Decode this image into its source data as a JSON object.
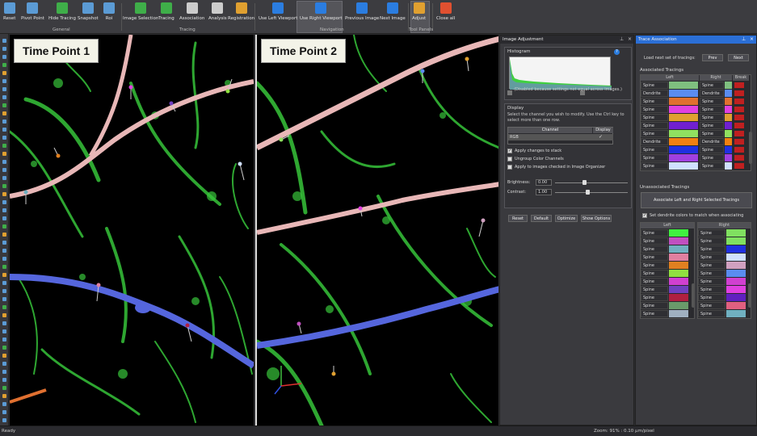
{
  "ribbon": {
    "buttons": [
      {
        "label": "Reset",
        "icon": "home-icon",
        "color": "#5b9bd5"
      },
      {
        "label": "Pivot Point",
        "icon": "crosshair-icon",
        "color": "#5b9bd5"
      },
      {
        "label": "Hide Tracing",
        "icon": "hide-tracing-icon",
        "color": "#3fae49"
      },
      {
        "label": "Snapshot",
        "icon": "camera-icon",
        "color": "#5b9bd5"
      },
      {
        "label": "Roi",
        "icon": "roi-icon",
        "color": "#5b9bd5"
      },
      {
        "label": "Image Selection",
        "icon": "image-selection-icon",
        "color": "#3fae49"
      },
      {
        "label": "Tracing",
        "icon": "pen-icon",
        "color": "#3fae49"
      },
      {
        "label": "Association",
        "icon": "association-icon",
        "color": "#cccccc"
      },
      {
        "label": "Analysis",
        "icon": "table-icon",
        "color": "#cccccc"
      },
      {
        "label": "Registration",
        "icon": "registration-icon",
        "color": "#e0a030"
      },
      {
        "label": "Use Left Viewport",
        "icon": "left-viewport-icon",
        "color": "#2b7de0"
      },
      {
        "label": "Use Right Viewport",
        "icon": "right-viewport-icon",
        "color": "#2b7de0"
      },
      {
        "label": "Previous Image",
        "icon": "arrow-left-icon",
        "color": "#2b7de0"
      },
      {
        "label": "Next Image",
        "icon": "arrow-right-icon",
        "color": "#2b7de0"
      },
      {
        "label": "Adjust",
        "icon": "adjust-icon",
        "color": "#e0a030"
      },
      {
        "label": "Close all",
        "icon": "close-all-icon",
        "color": "#e05030"
      }
    ],
    "groups": {
      "general": "General",
      "tracing": "Tracing",
      "navigation": "Navigation",
      "tool_panels": "Tool Panels"
    }
  },
  "viewports": {
    "left_title": "Time Point 1",
    "right_title": "Time Point 2"
  },
  "image_adjustment": {
    "title": "Image Adjustment",
    "histogram_label": "Histogram",
    "histogram_note": "(Disabled because settings not equal across images.)",
    "display_label": "Display",
    "display_help": "Select the channel you wish to modify. Use the Ctrl key to select more than one row.",
    "table_headers": {
      "channel": "Channel",
      "display": "Display"
    },
    "channel_row": {
      "channel": "RGB",
      "display": "✓"
    },
    "options": [
      {
        "label": "Apply changes to stack",
        "checked": true
      },
      {
        "label": "Ungroup Color Channels",
        "checked": false
      },
      {
        "label": "Apply to images checked in Image Organizer",
        "checked": false
      }
    ],
    "brightness_label": "Brightness:",
    "brightness_value": "0.00",
    "contrast_label": "Contrast:",
    "contrast_value": "1.00",
    "buttons": [
      "Reset",
      "Default",
      "Optimize",
      "Show Options"
    ]
  },
  "trace_association": {
    "title": "Trace Association",
    "load_label": "Load next set of tracings:",
    "prev_label": "Prev",
    "next_label": "Next",
    "associated_label": "Associated Tracings",
    "assoc_headers": {
      "left": "Left",
      "right": "Right",
      "break": "Break"
    },
    "associated": [
      {
        "left": "Spine",
        "lc": "#7fbf7f",
        "right": "Spine",
        "rc": "#7fbf7f"
      },
      {
        "left": "Dendrite",
        "lc": "#5a8cf0",
        "right": "Dendrite",
        "rc": "#5a8cf0"
      },
      {
        "left": "Spine",
        "lc": "#e07030",
        "right": "Spine",
        "rc": "#e07030"
      },
      {
        "left": "Spine",
        "lc": "#e040e0",
        "right": "Spine",
        "rc": "#e040e0"
      },
      {
        "left": "Spine",
        "lc": "#e0a030",
        "right": "Spine",
        "rc": "#e0a030"
      },
      {
        "left": "Spine",
        "lc": "#7020d0",
        "right": "Spine",
        "rc": "#7020d0"
      },
      {
        "left": "Spine",
        "lc": "#90e060",
        "right": "Spine",
        "rc": "#90e060"
      },
      {
        "left": "Dendrite",
        "lc": "#f08010",
        "right": "Dendrite",
        "rc": "#f08010"
      },
      {
        "left": "Spine",
        "lc": "#2030e0",
        "right": "Spine",
        "rc": "#2030e0"
      },
      {
        "left": "Spine",
        "lc": "#a040e0",
        "right": "Spine",
        "rc": "#a040e0"
      },
      {
        "left": "Spine",
        "lc": "#d0e0ff",
        "right": "Spine",
        "rc": "#d0e0ff"
      }
    ],
    "unassociated_label": "Unassociated Tracings",
    "associate_button": "Associate Left and Right Selected Tracings",
    "dendrite_option": "Set dendrite colors to match when associating",
    "unassoc_headers": {
      "left": "Left",
      "right": "Right"
    },
    "unassoc_left": [
      {
        "label": "Spine",
        "color": "#40f040"
      },
      {
        "label": "Spine",
        "color": "#c050c0"
      },
      {
        "label": "Spine",
        "color": "#70b0c0"
      },
      {
        "label": "Spine",
        "color": "#e080a0"
      },
      {
        "label": "Spine",
        "color": "#e08020"
      },
      {
        "label": "Spine",
        "color": "#90e040"
      },
      {
        "label": "Spine",
        "color": "#d040d0"
      },
      {
        "label": "Spine",
        "color": "#7040c0"
      },
      {
        "label": "Spine",
        "color": "#b02040"
      },
      {
        "label": "Spine",
        "color": "#6a9a6a"
      },
      {
        "label": "Spine",
        "color": "#a0b0c0"
      }
    ],
    "unassoc_right": [
      {
        "label": "Spine",
        "color": "#80e060"
      },
      {
        "label": "Spine",
        "color": "#80e060"
      },
      {
        "label": "Spine",
        "color": "#2030e0"
      },
      {
        "label": "Spine",
        "color": "#d0e0ff"
      },
      {
        "label": "Spine",
        "color": "#d0a0c0"
      },
      {
        "label": "Spine",
        "color": "#5a8cf0"
      },
      {
        "label": "Spine",
        "color": "#d040d0"
      },
      {
        "label": "Spine",
        "color": "#e040e0"
      },
      {
        "label": "Spine",
        "color": "#6020c0"
      },
      {
        "label": "Spine",
        "color": "#e06080"
      },
      {
        "label": "Spine",
        "color": "#70b0c0"
      }
    ]
  },
  "status": {
    "left": "Ready",
    "right": "Zoom: 91% : 0.10 µm/pixel"
  }
}
